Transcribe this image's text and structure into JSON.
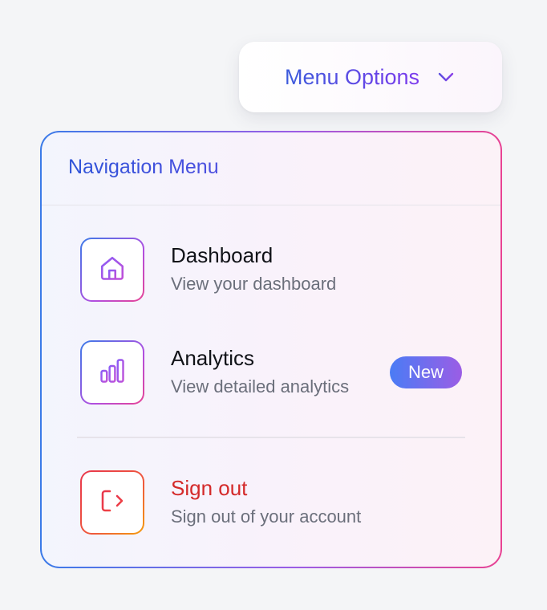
{
  "trigger": {
    "label": "Menu Options",
    "icon": "chevron-down-icon"
  },
  "menu": {
    "title": "Navigation Menu",
    "items": [
      {
        "title": "Dashboard",
        "description": "View your dashboard",
        "icon": "home-icon"
      },
      {
        "title": "Analytics",
        "description": "View detailed analytics",
        "icon": "bar-chart-icon",
        "badge": "New"
      },
      {
        "title": "Sign out",
        "description": "Sign out of your account",
        "icon": "sign-out-icon"
      }
    ]
  },
  "colors": {
    "accent_blue": "#3b5bdb",
    "accent_purple": "#7c3aed",
    "accent_pink": "#e84393",
    "danger": "#d42a2a"
  }
}
